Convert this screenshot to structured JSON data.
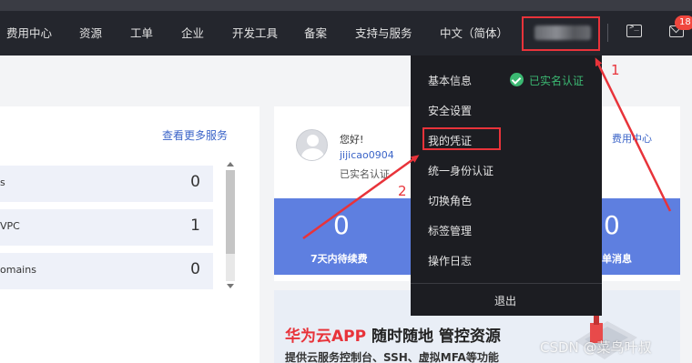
{
  "nav": {
    "items": [
      {
        "id": "billing",
        "label": "费用中心"
      },
      {
        "id": "resources",
        "label": "资源"
      },
      {
        "id": "tickets",
        "label": "工单"
      },
      {
        "id": "enterprise",
        "label": "企业"
      },
      {
        "id": "devtools",
        "label": "开发工具"
      },
      {
        "id": "icp",
        "label": "备案"
      },
      {
        "id": "support",
        "label": "支持与服务"
      },
      {
        "id": "language",
        "label": "中文（简体）"
      }
    ],
    "badge_count": "18",
    "icons": {
      "terminal": "terminal-icon",
      "mail": "mail-icon"
    }
  },
  "left": {
    "more_link": "查看更多服务",
    "rows": [
      {
        "label": "s",
        "count": "0"
      },
      {
        "label": "VPC",
        "count": "1"
      },
      {
        "label": "omains",
        "count": "0"
      }
    ]
  },
  "profile": {
    "greeting": "您好!",
    "username": "jijicao0904",
    "verified_short": "已实名认证",
    "fee_link": "费用中心",
    "stats": [
      {
        "value": "0",
        "label": "7天内待续费"
      },
      {
        "value": "0",
        "label": "单消息"
      }
    ]
  },
  "banner": {
    "title_red": "华为云APP",
    "title_rest": " 随时随地 管控资源",
    "subtitle": "提供云服务控制台、SSH、虚拟MFA等功能"
  },
  "dropdown": {
    "items": [
      {
        "id": "basic-info",
        "label": "基本信息"
      },
      {
        "id": "security",
        "label": "安全设置"
      },
      {
        "id": "credentials",
        "label": "我的凭证"
      },
      {
        "id": "identity",
        "label": "统一身份认证"
      },
      {
        "id": "switch-role",
        "label": "切换角色"
      },
      {
        "id": "tags",
        "label": "标签管理"
      },
      {
        "id": "logs",
        "label": "操作日志"
      }
    ],
    "verified_label": "已实名认证",
    "logout": "退出"
  },
  "annotations": {
    "step1": "1",
    "step2": "2"
  },
  "watermark": "CSDN @菜鸟叶叔",
  "colors": {
    "accent_red": "#e8333a",
    "nav_bg": "#24262d",
    "stat_blue": "#5e7fe0",
    "verified_green": "#3bb872",
    "link_blue": "#3b64c8"
  }
}
